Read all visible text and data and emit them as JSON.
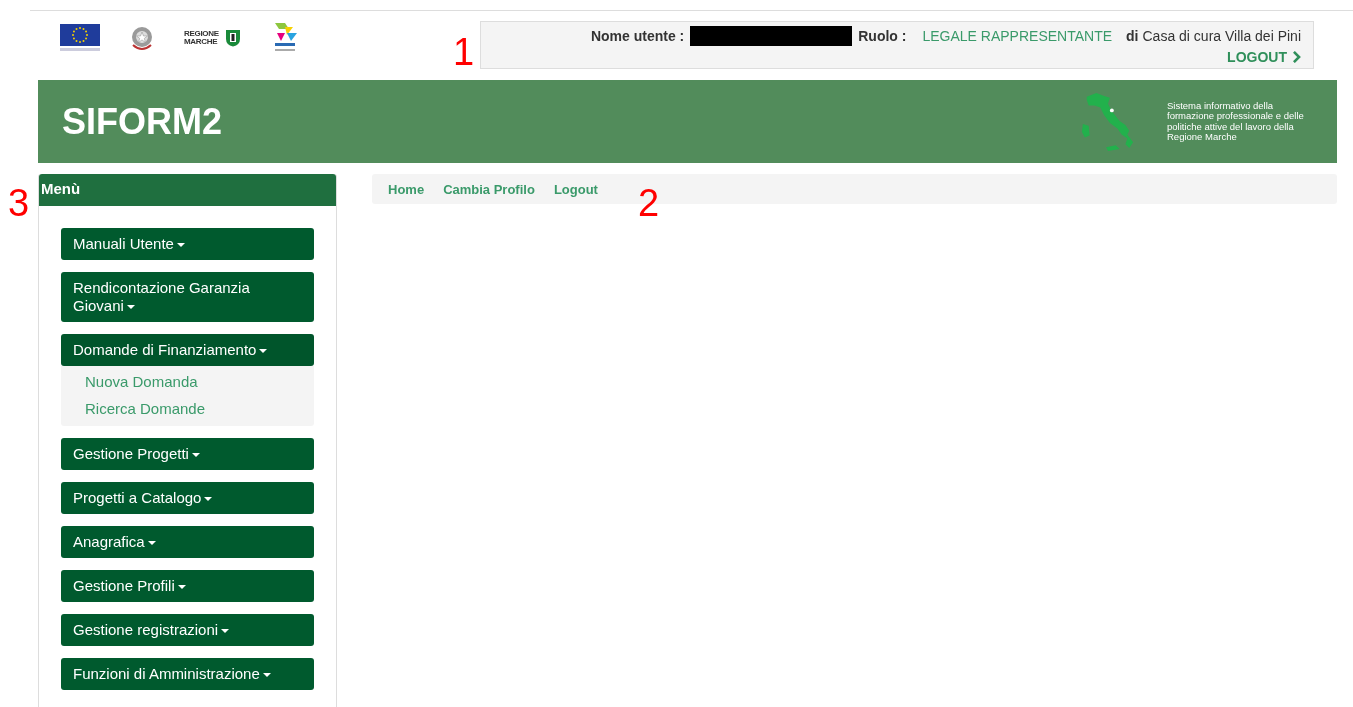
{
  "logos": {
    "region_logo_text": "REGIONE MARCHE"
  },
  "user_box": {
    "user_label": "Nome utente :",
    "user_redacted": true,
    "role_label": "Ruolo :",
    "role": "LEGALE RAPPRESENTANTE",
    "of_label": "di",
    "organization": "Casa di cura Villa dei Pini",
    "logout": "LOGOUT"
  },
  "header": {
    "title": "SIFORM2",
    "description": "Sistema informativo della formazione professionale e delle politiche attive del lavoro della Regione Marche"
  },
  "menu": {
    "title": "Menù",
    "items": [
      {
        "label": "Manuali Utente",
        "expanded": false
      },
      {
        "label": "Rendicontazione Garanzia Giovani",
        "expanded": false
      },
      {
        "label": "Domande di Finanziamento",
        "expanded": true,
        "children": [
          {
            "label": "Nuova Domanda"
          },
          {
            "label": "Ricerca Domande"
          }
        ]
      },
      {
        "label": "Gestione Progetti",
        "expanded": false
      },
      {
        "label": "Progetti a Catalogo",
        "expanded": false
      },
      {
        "label": "Anagrafica",
        "expanded": false
      },
      {
        "label": "Gestione Profili",
        "expanded": false
      },
      {
        "label": "Gestione registrazioni",
        "expanded": false
      },
      {
        "label": "Funzioni di Amministrazione",
        "expanded": false
      }
    ]
  },
  "breadcrumb": [
    {
      "label": "Home"
    },
    {
      "label": "Cambia Profilo"
    },
    {
      "label": "Logout"
    }
  ],
  "annotations": [
    {
      "label": "1"
    },
    {
      "label": "2"
    },
    {
      "label": "3"
    }
  ]
}
